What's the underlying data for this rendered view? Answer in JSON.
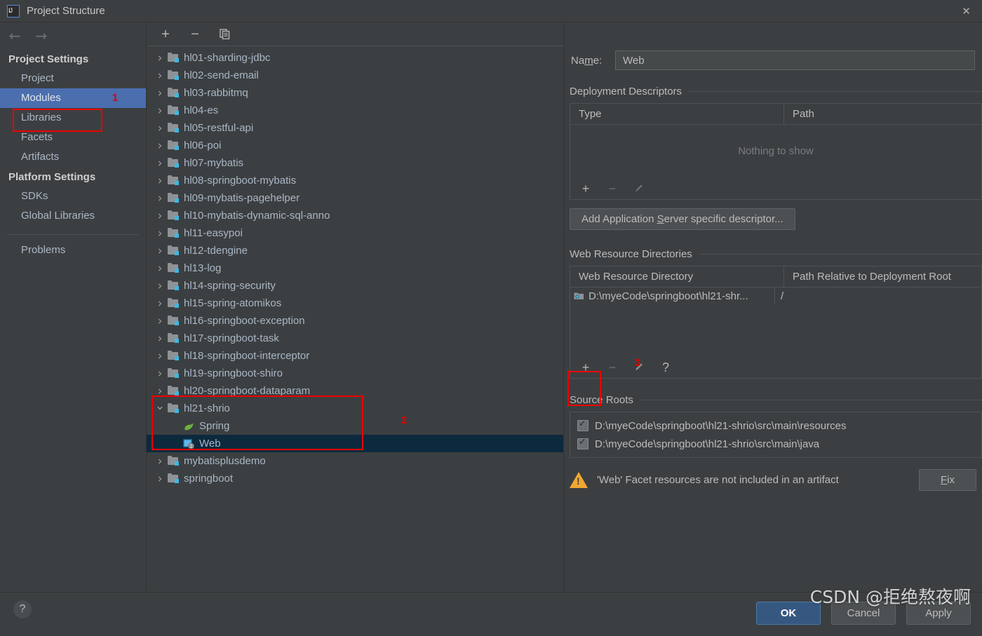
{
  "window": {
    "title": "Project Structure",
    "logo_icon": "intellij-idea-logo",
    "close_icon": "close-icon"
  },
  "sidebar": {
    "back_icon": "arrow-left-icon",
    "forward_icon": "arrow-right-icon",
    "groups": [
      {
        "label": "Project Settings",
        "items": [
          {
            "label": "Project",
            "selected": false
          },
          {
            "label": "Modules",
            "selected": true
          },
          {
            "label": "Libraries",
            "selected": false
          },
          {
            "label": "Facets",
            "selected": false
          },
          {
            "label": "Artifacts",
            "selected": false
          }
        ]
      },
      {
        "label": "Platform Settings",
        "items": [
          {
            "label": "SDKs",
            "selected": false
          },
          {
            "label": "Global Libraries",
            "selected": false
          }
        ]
      }
    ],
    "problems_label": "Problems"
  },
  "annotations": {
    "one": "1",
    "two": "2",
    "three": "3",
    "color": "#e00000"
  },
  "tree": {
    "toolbar": [
      {
        "icon": "add-icon",
        "glyph": "+"
      },
      {
        "icon": "remove-icon",
        "glyph": "−"
      },
      {
        "icon": "copy-icon",
        "glyph": "❐"
      }
    ],
    "rows": [
      {
        "label": "hl01-sharding-jdbc",
        "icon": "module-icon",
        "state": "closed",
        "level": 0
      },
      {
        "label": "hl02-send-email",
        "icon": "module-icon",
        "state": "closed",
        "level": 0
      },
      {
        "label": "hl03-rabbitmq",
        "icon": "module-icon",
        "state": "closed",
        "level": 0
      },
      {
        "label": "hl04-es",
        "icon": "module-icon",
        "state": "closed",
        "level": 0
      },
      {
        "label": "hl05-restful-api",
        "icon": "module-icon",
        "state": "closed",
        "level": 0
      },
      {
        "label": "hl06-poi",
        "icon": "module-icon",
        "state": "closed",
        "level": 0
      },
      {
        "label": "hl07-mybatis",
        "icon": "module-icon",
        "state": "closed",
        "level": 0
      },
      {
        "label": "hl08-springboot-mybatis",
        "icon": "module-icon",
        "state": "closed",
        "level": 0
      },
      {
        "label": "hl09-mybatis-pagehelper",
        "icon": "module-icon",
        "state": "closed",
        "level": 0
      },
      {
        "label": "hl10-mybatis-dynamic-sql-anno",
        "icon": "module-icon",
        "state": "closed",
        "level": 0
      },
      {
        "label": "hl11-easypoi",
        "icon": "module-icon",
        "state": "closed",
        "level": 0
      },
      {
        "label": "hl12-tdengine",
        "icon": "module-icon",
        "state": "closed",
        "level": 0
      },
      {
        "label": "hl13-log",
        "icon": "module-icon",
        "state": "closed",
        "level": 0
      },
      {
        "label": "hl14-spring-security",
        "icon": "module-icon",
        "state": "closed",
        "level": 0
      },
      {
        "label": "hl15-spring-atomikos",
        "icon": "module-icon",
        "state": "closed",
        "level": 0
      },
      {
        "label": "hl16-springboot-exception",
        "icon": "module-icon",
        "state": "closed",
        "level": 0
      },
      {
        "label": "hl17-springboot-task",
        "icon": "module-icon",
        "state": "closed",
        "level": 0
      },
      {
        "label": "hl18-springboot-interceptor",
        "icon": "module-icon",
        "state": "closed",
        "level": 0
      },
      {
        "label": "hl19-springboot-shiro",
        "icon": "module-icon",
        "state": "closed",
        "level": 0
      },
      {
        "label": "hl20-springboot-dataparam",
        "icon": "module-icon",
        "state": "closed",
        "level": 0
      },
      {
        "label": "hl21-shrio",
        "icon": "module-icon",
        "state": "open",
        "level": 0
      },
      {
        "label": "Spring",
        "icon": "spring-facet-icon",
        "state": "none",
        "level": 1
      },
      {
        "label": "Web",
        "icon": "web-facet-icon",
        "state": "none",
        "level": 1,
        "selected": true
      },
      {
        "label": "mybatisplusdemo",
        "icon": "module-icon",
        "state": "closed",
        "level": 0
      },
      {
        "label": "springboot",
        "icon": "module-icon",
        "state": "closed",
        "level": 0
      }
    ]
  },
  "detail": {
    "name_label_pre": "Na",
    "name_label_mnemonic": "m",
    "name_label_post": "e:",
    "name_value": "Web",
    "deployment": {
      "title": "Deployment Descriptors",
      "columns": [
        "Type",
        "Path"
      ],
      "empty_message": "Nothing to show",
      "toolbar": [
        {
          "icon": "add-icon",
          "glyph": "+",
          "enabled": true
        },
        {
          "icon": "remove-icon",
          "glyph": "−",
          "enabled": false
        },
        {
          "icon": "edit-pencil-icon",
          "glyph": "✎",
          "enabled": false
        }
      ],
      "add_descriptor_pre": "Add Application ",
      "add_descriptor_mnemonic": "S",
      "add_descriptor_post": "erver specific descriptor..."
    },
    "web_resources": {
      "title": "Web Resource Directories",
      "columns": [
        "Web Resource Directory",
        "Path Relative to Deployment Root"
      ],
      "rows": [
        {
          "directory": "D:\\myeCode\\springboot\\hl21-shr...",
          "relative_path": "/",
          "icon": "folder-web-icon"
        }
      ],
      "toolbar": [
        {
          "icon": "add-icon",
          "glyph": "+",
          "enabled": true
        },
        {
          "icon": "remove-icon",
          "glyph": "−",
          "enabled": false
        },
        {
          "icon": "edit-pencil-icon",
          "glyph": "✎",
          "enabled": false
        },
        {
          "icon": "help-question-icon",
          "glyph": "?",
          "enabled": true
        }
      ]
    },
    "source_roots": {
      "title": "Source Roots",
      "rows": [
        {
          "path": "D:\\myeCode\\springboot\\hl21-shrio\\src\\main\\resources",
          "checked": true
        },
        {
          "path": "D:\\myeCode\\springboot\\hl21-shrio\\src\\main\\java",
          "checked": true
        }
      ]
    },
    "warning": {
      "icon": "warning-triangle-icon",
      "text": "'Web' Facet resources are not included in an artifact",
      "fix_mnemonic": "F",
      "fix_post": "ix",
      "color": "#f0a732"
    }
  },
  "footer": {
    "help_icon": "help-question-icon",
    "buttons": [
      {
        "label": "OK",
        "primary": true
      },
      {
        "label": "Cancel",
        "primary": false
      },
      {
        "label": "Apply",
        "primary": false
      }
    ],
    "watermark": "CSDN @拒绝熬夜啊"
  }
}
